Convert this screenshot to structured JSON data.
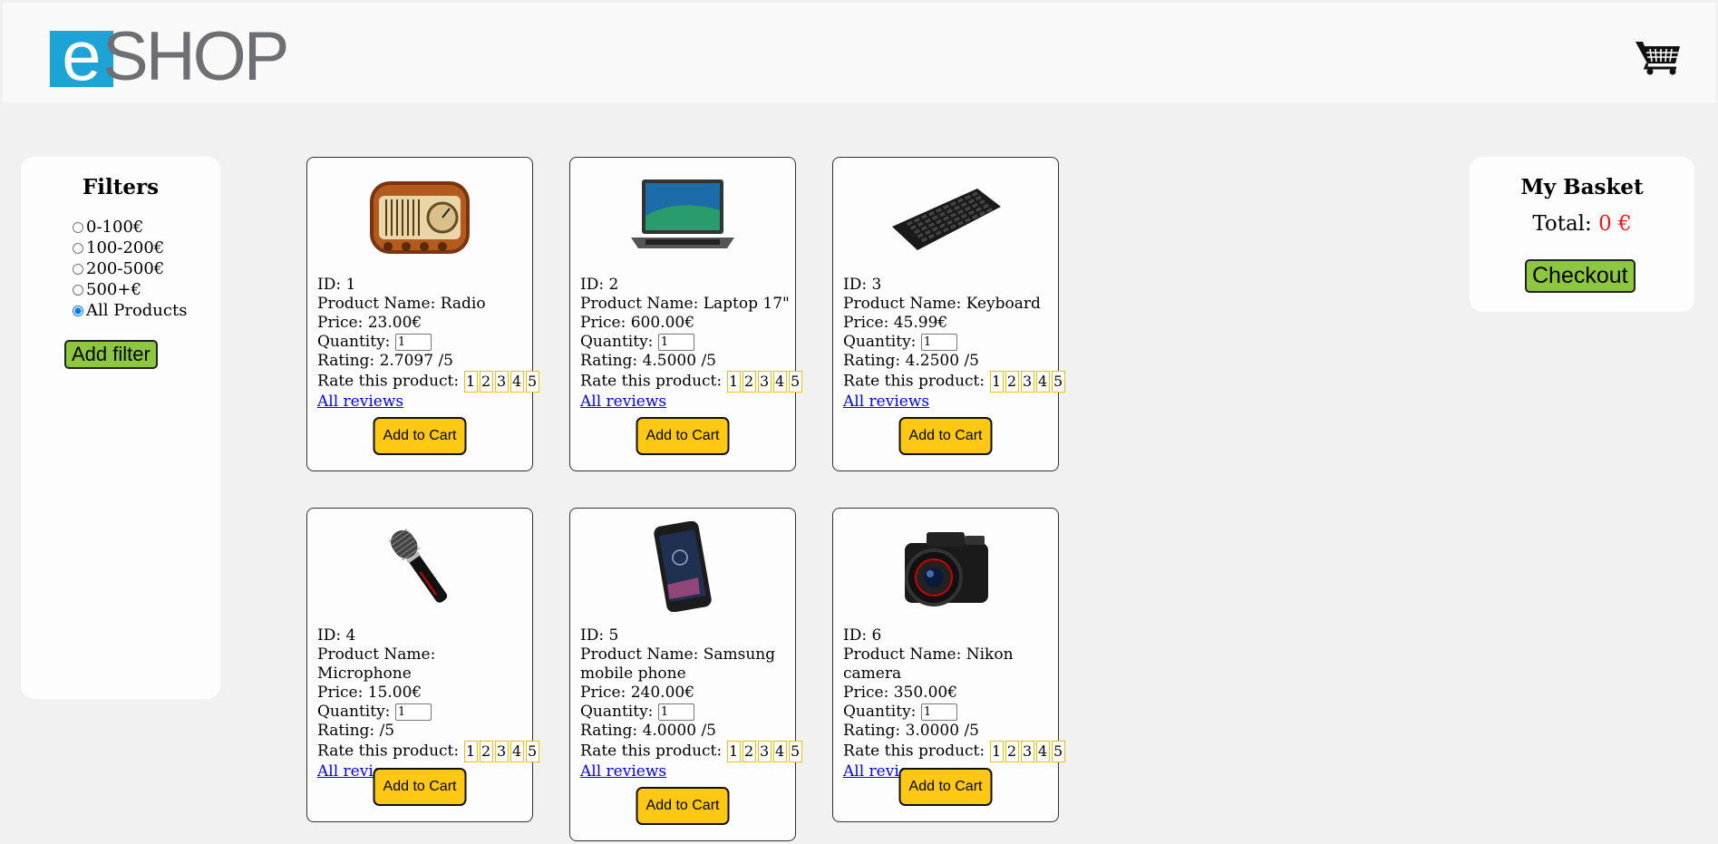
{
  "header": {
    "logo_e": "e",
    "logo_shop": "SHOP",
    "cart_icon": "shopping-cart-icon"
  },
  "filters": {
    "title": "Filters",
    "options": [
      "0-100€",
      "100-200€",
      "200-500€",
      "500+€",
      "All Products"
    ],
    "selected": "All Products",
    "button": "Add filter"
  },
  "basket": {
    "title": "My Basket",
    "total_label": "Total:",
    "total_value": "0 €",
    "checkout": "Checkout"
  },
  "labels": {
    "id": "ID:",
    "name": "Product Name:",
    "price": "Price:",
    "quantity": "Quantity:",
    "rating": "Rating:",
    "rate": "Rate this product:",
    "reviews": "All reviews",
    "add_to_cart": "Add to Cart",
    "rating_suffix": "/5"
  },
  "rate_values": [
    "1",
    "2",
    "3",
    "4",
    "5"
  ],
  "products": [
    {
      "id": "1",
      "name": "Radio",
      "price": "23.00€",
      "qty": "1",
      "rating": "2.7097",
      "icon": "radio-icon"
    },
    {
      "id": "2",
      "name": "Laptop 17\"",
      "price": "600.00€",
      "qty": "1",
      "rating": "4.5000",
      "icon": "laptop-icon"
    },
    {
      "id": "3",
      "name": "Keyboard",
      "price": "45.99€",
      "qty": "1",
      "rating": "4.2500",
      "icon": "keyboard-icon"
    },
    {
      "id": "4",
      "name": "Microphone",
      "price": "15.00€",
      "qty": "1",
      "rating": "",
      "icon": "microphone-icon"
    },
    {
      "id": "5",
      "name": "Samsung mobile phone",
      "price": "240.00€",
      "qty": "1",
      "rating": "4.0000",
      "icon": "phone-icon"
    },
    {
      "id": "6",
      "name": "Nikon camera",
      "price": "350.00€",
      "qty": "1",
      "rating": "3.0000",
      "icon": "camera-icon"
    }
  ],
  "colors": {
    "accent_green": "#8dc63f",
    "button_yellow": "#ffc815",
    "logo_blue": "#1ea3d6",
    "total_red": "#ff1414"
  }
}
